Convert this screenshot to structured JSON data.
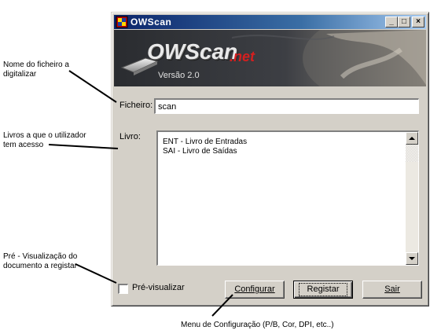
{
  "annotations": {
    "file_name": [
      "Nome do ficheiro a",
      "digitalizar"
    ],
    "books": [
      "Livros a que o utilizador",
      "tem acesso"
    ],
    "preview": [
      "Pré - Visualização do",
      "documento a registar"
    ],
    "config_menu": "Menu de Configuração (P/B, Cor, DPI, etc..)"
  },
  "window": {
    "title": "OWScan",
    "controls": {
      "minimize": "_",
      "maximize": "□",
      "close": "×"
    },
    "banner": {
      "logo_main": "OWScan",
      "logo_suffix": ".net",
      "version": "Versão 2.0"
    }
  },
  "form": {
    "ficheiro_label": "Ficheiro:",
    "ficheiro_value": "scan",
    "livro_label": "Livro:",
    "livros": [
      "ENT - Livro de Entradas",
      "SAI - Livro de Saídas"
    ],
    "preview_label": "Pré-visualizar",
    "preview_checked": false
  },
  "buttons": {
    "configurar": "Configurar",
    "registar": "Registar",
    "sair": "Sair"
  },
  "colors": {
    "titlebar_start": "#0a246a",
    "titlebar_end": "#a6caf0",
    "face": "#d4d0c8",
    "banner_bg": "#2a2c30"
  }
}
